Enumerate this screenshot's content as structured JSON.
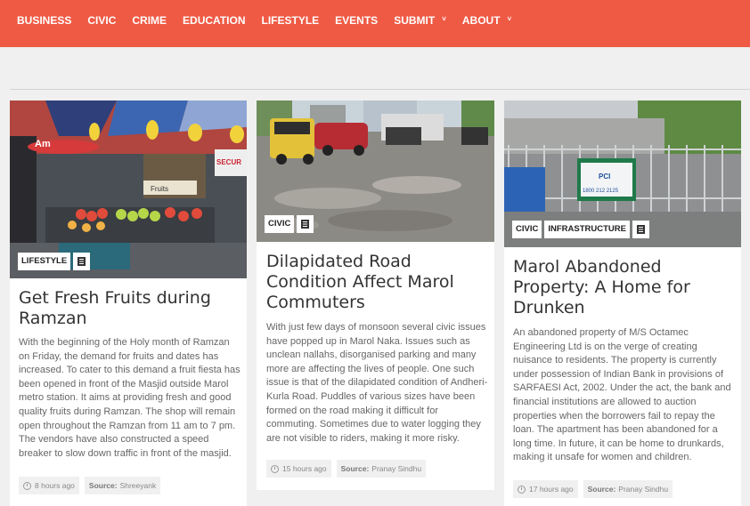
{
  "nav": {
    "items": [
      {
        "label": "BUSINESS",
        "dropdown": false
      },
      {
        "label": "CIVIC",
        "dropdown": false
      },
      {
        "label": "CRIME",
        "dropdown": false
      },
      {
        "label": "EDUCATION",
        "dropdown": false
      },
      {
        "label": "LIFESTYLE",
        "dropdown": false
      },
      {
        "label": "EVENTS",
        "dropdown": false
      },
      {
        "label": "SUBMIT",
        "dropdown": true
      },
      {
        "label": "ABOUT",
        "dropdown": true
      }
    ],
    "caret": "˅"
  },
  "colors": {
    "nav_bg": "#ef5a45",
    "page_bg": "#f0f0f0",
    "card_bg": "#ffffff"
  },
  "articles": [
    {
      "tags": [
        "LIFESTYLE"
      ],
      "title": "Get Fresh Fruits during Ramzan",
      "excerpt": "With the beginning of the Holy month of Ramzan on Friday, the demand for fruits and dates has increased. To cater to this demand a fruit fiesta has been opened in front of the Masjid outside Marol metro station. It aims at providing fresh and good quality fruits during Ramzan. The shop will remain open throughout the Ramzan from 11 am to 7 pm. The vendors have also constructed a speed breaker to slow down traffic in front of the masjid.",
      "time": "8 hours ago",
      "source_label": "Source:",
      "source": "Shreeyank",
      "image_text": [
        "Am",
        "SECUR",
        "Fruits"
      ]
    },
    {
      "tags": [
        "CIVIC"
      ],
      "title": "Dilapidated Road Condition Affect Marol Commuters",
      "excerpt": "With just few days of monsoon several civic issues have popped up in Marol Naka. Issues such as unclean nallahs, disorganised parking and many more are affecting the lives of people. One such issue is that of the dilapidated condition of Andheri-Kurla Road. Puddles of various sizes have been formed on the road making it difficult for commuting. Sometimes due to water logging they are not visible to riders, making it more risky.",
      "time": "15 hours ago",
      "source_label": "Source:",
      "source": "Pranay Sindhu"
    },
    {
      "tags": [
        "CIVIC",
        "INFRASTRUCTURE"
      ],
      "title": "Marol Abandoned Property: A Home for Drunken",
      "excerpt": "An abandoned property of M/S Octamec Engineering Ltd is on the verge of creating nuisance to residents. The property is currently under possession of Indian Bank in provisions of SARFAESI Act, 2002. Under the act, the bank and financial institutions are allowed to auction properties when the borrowers fail to repay the loan. The apartment has been abandoned for a long time. In future, it can be home to drunkards, making it unsafe for women and children.",
      "time": "17 hours ago",
      "source_label": "Source:",
      "source": "Pranay Sindhu",
      "image_text": [
        "PCI",
        "1800 212 2125"
      ]
    }
  ]
}
